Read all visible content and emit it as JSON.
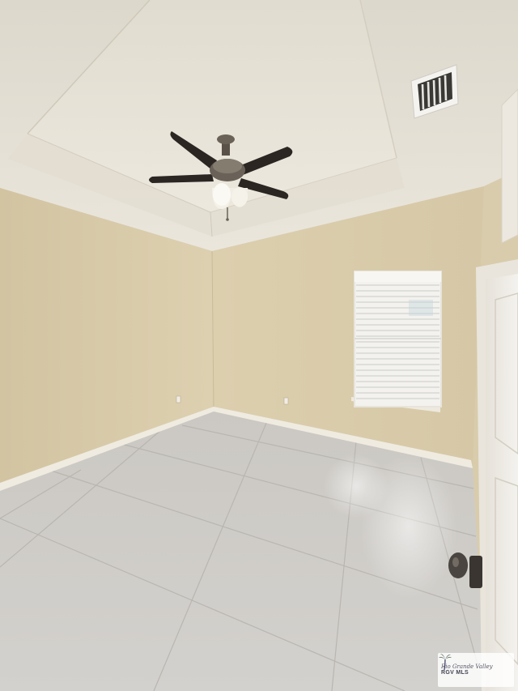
{
  "scene": {
    "description_type": "empty room interior photograph",
    "colors": {
      "wall_left": "#d6c9a8",
      "wall_back": "#d9cba9",
      "ceiling": "#e6e2d8",
      "floor_tile": "#cfcdca",
      "baseboard": "#ece8dd",
      "fan_blade": "#2b2622",
      "window_blind": "#f1f1f0",
      "door": "#efece6"
    }
  },
  "watermark": {
    "line1": "Rio Grande Valley",
    "line2": "RGV MLS"
  }
}
